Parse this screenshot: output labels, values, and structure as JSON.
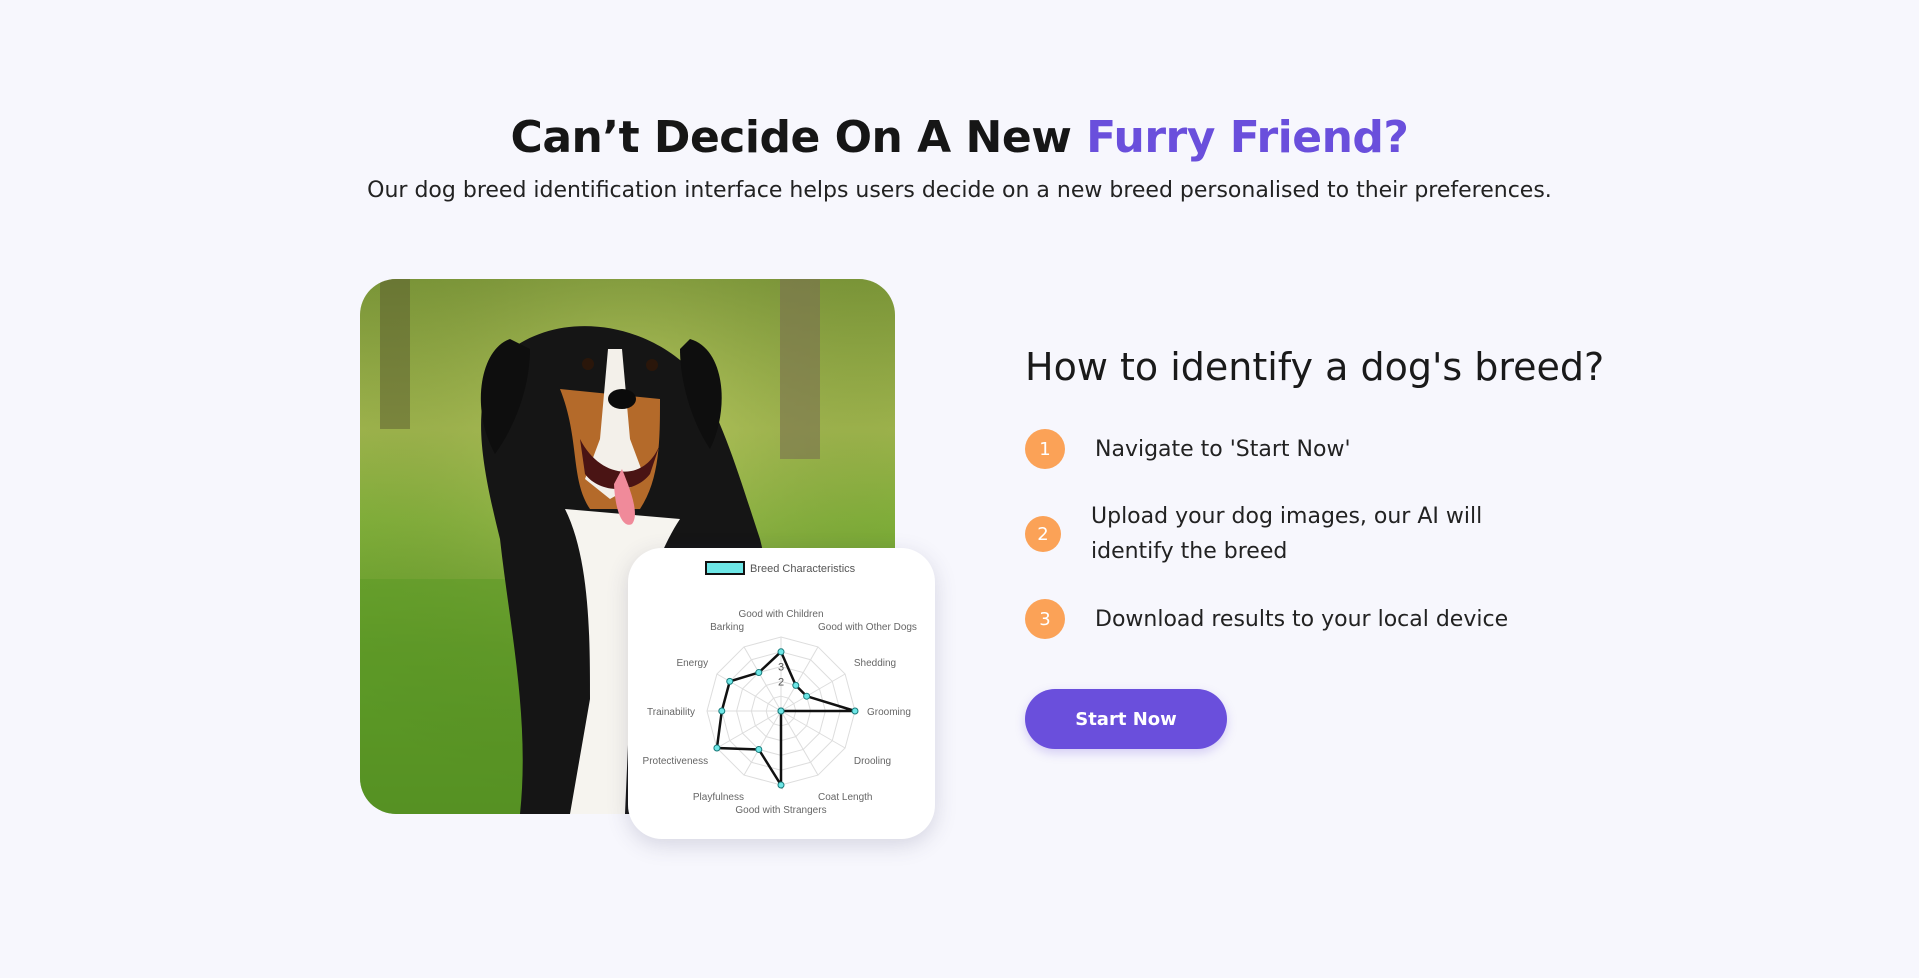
{
  "hero": {
    "title_main": "Can’t Decide On A New ",
    "title_accent": "Furry Friend?",
    "subtitle": "Our dog breed identification interface helps users decide on a new breed personalised to their preferences."
  },
  "image": {
    "subject": "dog photo"
  },
  "chart_data": {
    "type": "radar",
    "legend": "Breed Characteristics",
    "categories": [
      "Good with Children",
      "Good with Other Dogs",
      "Shedding",
      "Grooming",
      "Drooling",
      "Coat Length",
      "Good with Strangers",
      "Playfulness",
      "Protectiveness",
      "Trainability",
      "Energy",
      "Barking"
    ],
    "values": [
      4,
      2,
      2,
      5,
      0,
      0,
      5,
      3,
      5,
      4,
      4,
      3
    ],
    "ticks": [
      "2",
      "3",
      "4"
    ],
    "rmax": 5,
    "colors": {
      "line": "#111111",
      "point_fill": "#6ee7e7",
      "grid": "#dddddd"
    }
  },
  "how": {
    "title": "How to identify a dog's breed?",
    "steps": [
      {
        "num": "1",
        "text": "Navigate to 'Start Now'"
      },
      {
        "num": "2",
        "text": "Upload your dog images, our AI will identify the breed"
      },
      {
        "num": "3",
        "text": "Download results to your local device"
      }
    ],
    "button": "Start Now"
  },
  "colors": {
    "accent": "#6a4fdc",
    "step_badge": "#fba257",
    "background": "#f7f7fd"
  }
}
